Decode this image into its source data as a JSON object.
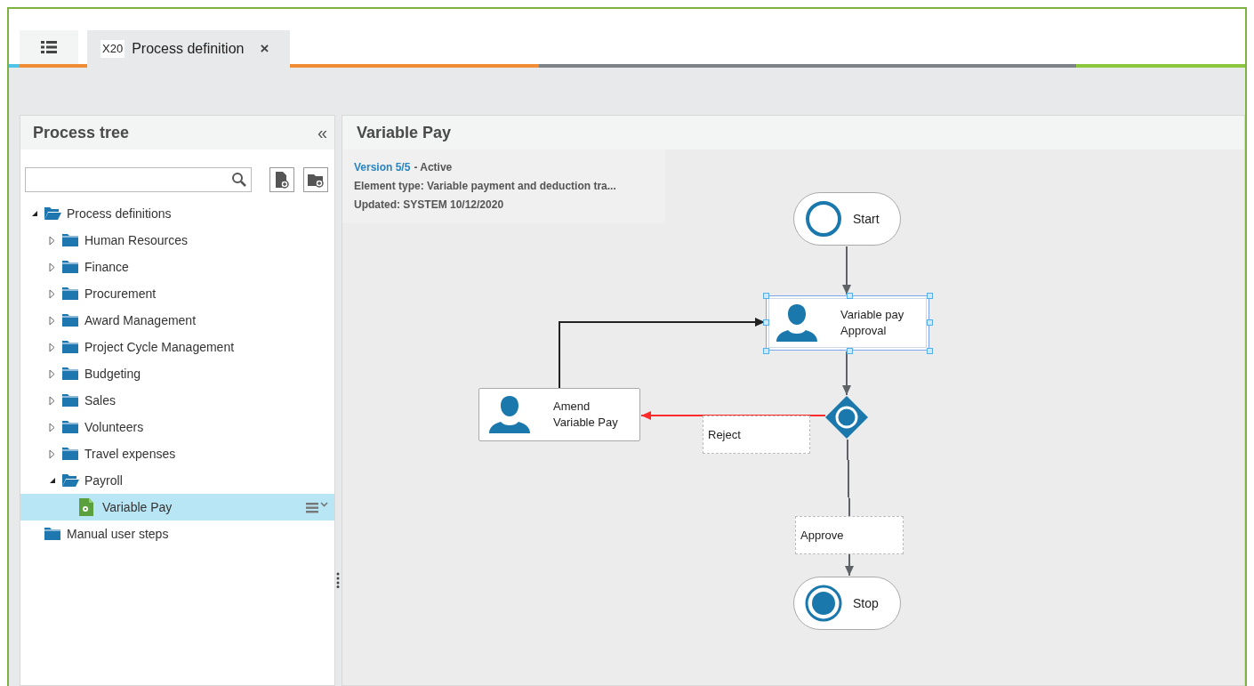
{
  "tabs": [
    {
      "kind": "menu",
      "selected": false
    },
    {
      "kind": "document",
      "badge": "X20",
      "label": "Process definition",
      "close": "×",
      "selected": true
    }
  ],
  "process_tree": {
    "title": "Process tree",
    "collapse": "«",
    "items": [
      {
        "kind": "folder",
        "label": "Process definitions",
        "expanded": true,
        "selected": false,
        "children": [
          {
            "kind": "folder",
            "label": "Human Resources",
            "expanded": false,
            "selected": false
          },
          {
            "kind": "folder",
            "label": "Finance",
            "expanded": false,
            "selected": false
          },
          {
            "kind": "folder",
            "label": "Procurement",
            "expanded": false,
            "selected": false
          },
          {
            "kind": "folder",
            "label": "Award Management",
            "expanded": false,
            "selected": false
          },
          {
            "kind": "folder",
            "label": "Project Cycle Management",
            "expanded": false,
            "selected": false
          },
          {
            "kind": "folder",
            "label": "Budgeting",
            "expanded": false,
            "selected": false
          },
          {
            "kind": "folder",
            "label": "Sales",
            "expanded": false,
            "selected": false
          },
          {
            "kind": "folder",
            "label": "Volunteers",
            "expanded": false,
            "selected": false
          },
          {
            "kind": "folder",
            "label": "Travel expenses",
            "expanded": false,
            "selected": false
          },
          {
            "kind": "folder",
            "label": "Payroll",
            "expanded": true,
            "selected": false,
            "children": [
              {
                "kind": "process",
                "label": "Variable Pay",
                "selected": true
              }
            ]
          }
        ]
      },
      {
        "kind": "leaf-folder",
        "label": "Manual user steps",
        "selected": false
      }
    ]
  },
  "detail": {
    "title": "Variable Pay",
    "version": "Version 5/5",
    "status": "- Active",
    "element_type": "Element type: Variable payment and deduction tra...",
    "updated": "Updated: SYSTEM 10/12/2020",
    "nodes": [
      {
        "kind": "start",
        "label": "Start",
        "selected": false
      },
      {
        "kind": "task",
        "label": "Variable pay Approval",
        "selected": true
      },
      {
        "kind": "gateway",
        "selected": false
      },
      {
        "kind": "task",
        "label": "Amend Variable Pay",
        "selected": false
      },
      {
        "kind": "stop",
        "label": "Stop",
        "selected": false
      }
    ],
    "edges": [
      {
        "color": "#5f6368"
      },
      {
        "color": "#5f6368"
      },
      {
        "color": "#ff2a2a",
        "label": "Reject"
      },
      {
        "color": "#222222"
      },
      {
        "color": "#5f6368",
        "label": "Approve"
      }
    ]
  }
}
